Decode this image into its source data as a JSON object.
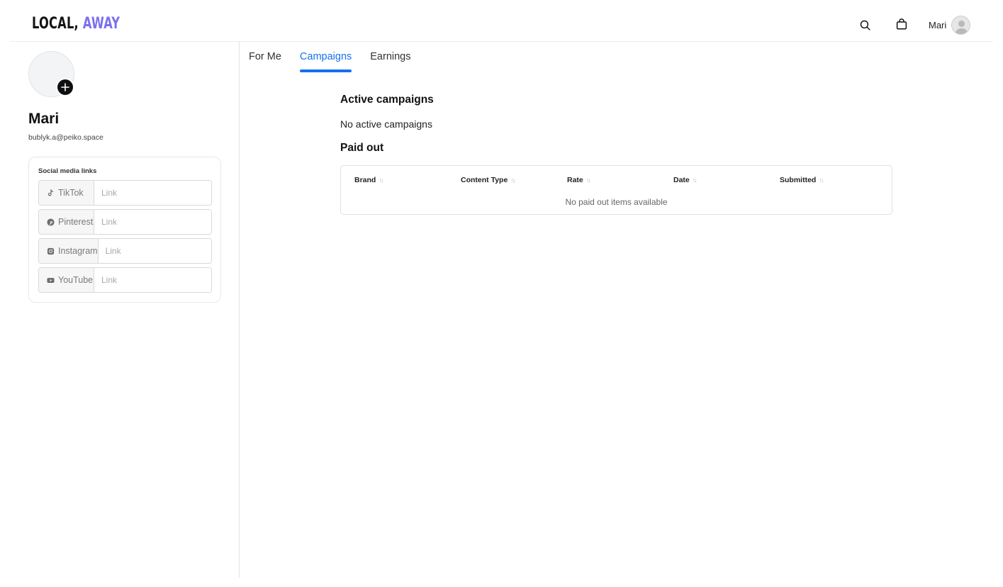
{
  "header": {
    "logo_part1": "LOCAL,",
    "logo_part2": " AWAY",
    "logo_accent_color": "#7b6ff0",
    "icons": [
      "search-icon",
      "shopping-bag-icon"
    ],
    "user_name": "Mari"
  },
  "profile": {
    "name": "Mari",
    "email": "bublyk.a@peiko.space"
  },
  "social": {
    "title": "Social media links",
    "items": [
      {
        "label": "TikTok",
        "icon": "tiktok-icon",
        "placeholder": "Link",
        "value": ""
      },
      {
        "label": "Pinterest",
        "icon": "pinterest-icon",
        "placeholder": "Link",
        "value": ""
      },
      {
        "label": "Instagram",
        "icon": "instagram-icon",
        "placeholder": "Link",
        "value": ""
      },
      {
        "label": "YouTube",
        "icon": "youtube-icon",
        "placeholder": "Link",
        "value": ""
      }
    ]
  },
  "tabs": [
    {
      "label": "For Me",
      "active": false
    },
    {
      "label": "Campaigns",
      "active": true
    },
    {
      "label": "Earnings",
      "active": false
    }
  ],
  "accent_color": "#1570ef",
  "campaigns": {
    "active_title": "Active campaigns",
    "active_empty": "No active campaigns",
    "paid_title": "Paid out",
    "columns": [
      "Brand",
      "Content Type",
      "Rate",
      "Date",
      "Submitted"
    ],
    "paid_empty": "No paid out items available"
  }
}
